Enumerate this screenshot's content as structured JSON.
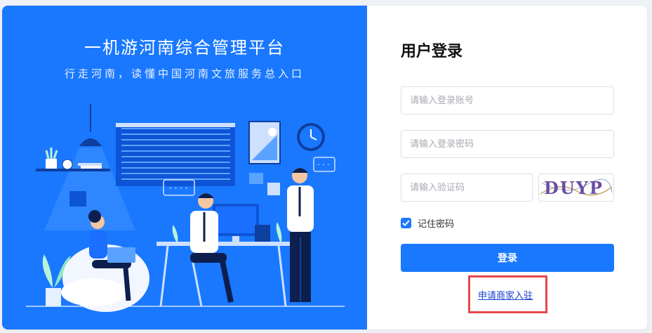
{
  "colors": {
    "primary": "#1a78ff",
    "highlight_border": "#e5484d"
  },
  "banner": {
    "title": "一机游河南综合管理平台",
    "subtitle": "行走河南，读懂中国河南文旅服务总入口"
  },
  "login": {
    "title": "用户登录",
    "account_placeholder": "请输入登录账号",
    "password_placeholder": "请输入登录密码",
    "captcha_placeholder": "请输入验证码",
    "captcha_code": "DUYP",
    "remember_label": "记住密码",
    "remember_checked": true,
    "submit_label": "登录",
    "apply_link": "申请商家入驻"
  }
}
